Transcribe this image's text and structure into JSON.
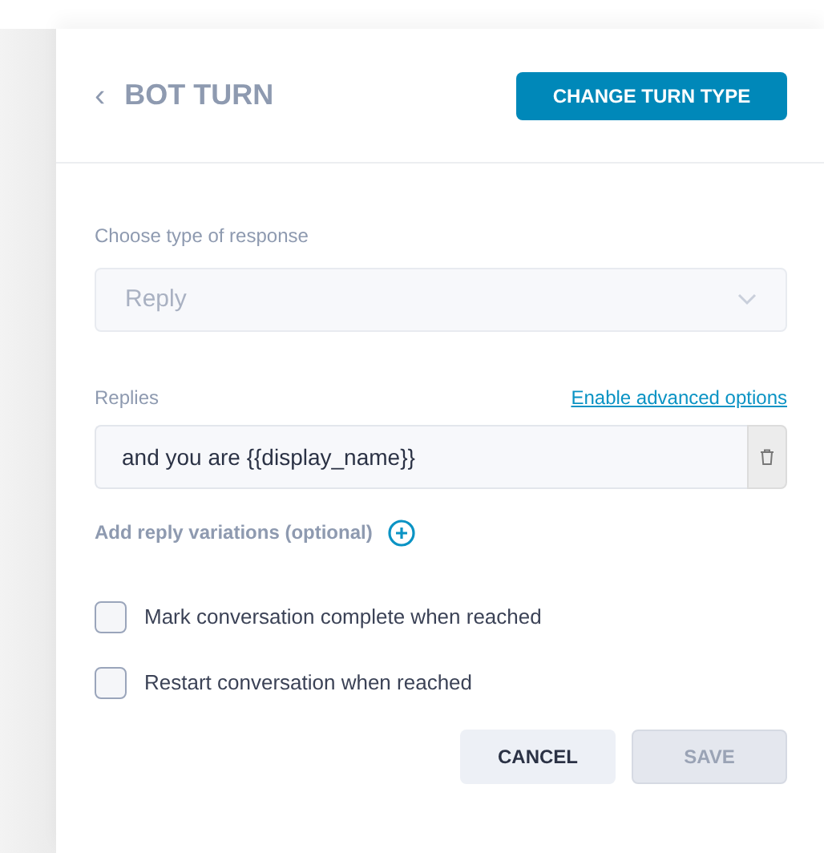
{
  "header": {
    "back_icon": "‹",
    "title": "BOT TURN",
    "action": "CHANGE TURN TYPE"
  },
  "response_type": {
    "label": "Choose type of response",
    "value": "Reply",
    "disabled": true
  },
  "replies": {
    "label": "Replies",
    "link": "Enable advanced options",
    "items": [
      {
        "value": "and you are {{display_name}}"
      }
    ],
    "add_label": "Add reply variations (optional)"
  },
  "options": [
    {
      "label": "Mark conversation complete when reached",
      "checked": false
    },
    {
      "label": "Restart conversation when reached",
      "checked": false
    }
  ],
  "buttons": [
    {
      "label": "CANCEL",
      "disabled": false
    },
    {
      "label": "SAVE",
      "disabled": true
    }
  ]
}
